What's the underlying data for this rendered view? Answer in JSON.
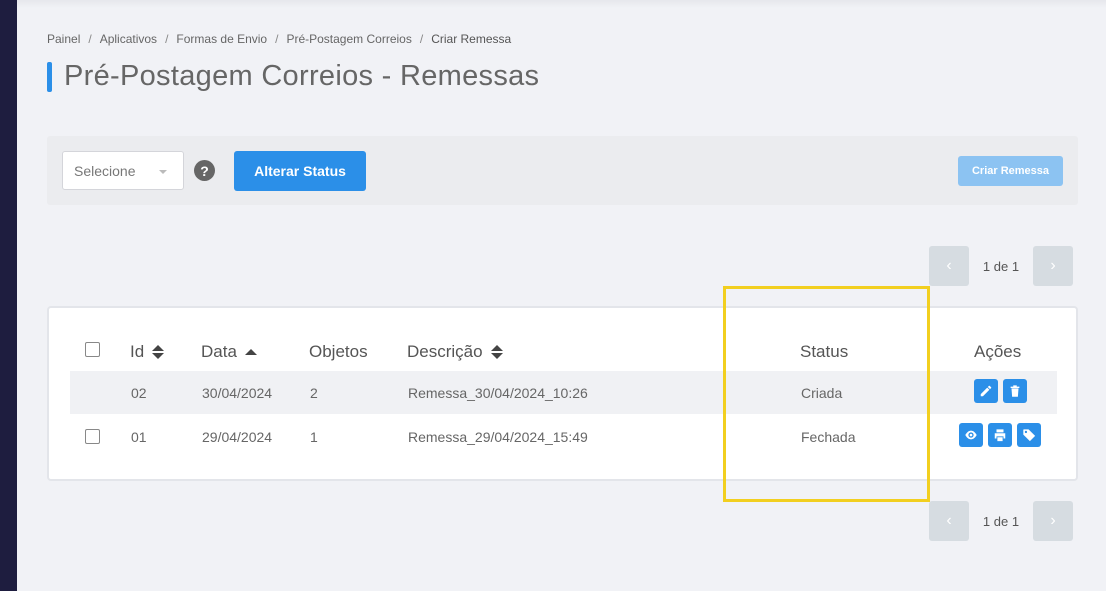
{
  "breadcrumb": {
    "items": [
      "Painel",
      "Aplicativos",
      "Formas de Envio",
      "Pré-Postagem Correios",
      "Criar Remessa"
    ],
    "separator": "/"
  },
  "page": {
    "title": "Pré-Postagem Correios - Remessas",
    "accent_color": "#2b8fe8"
  },
  "toolbar": {
    "select_value": "Selecione",
    "help_symbol": "?",
    "alter_status_label": "Alterar Status",
    "create_label": "Criar Remessa"
  },
  "pagination": {
    "text": "1 de 1",
    "prev_symbol": "‹",
    "next_symbol": "›"
  },
  "table": {
    "headers": {
      "id": "Id",
      "data": "Data",
      "objetos": "Objetos",
      "descricao": "Descrição",
      "status": "Status",
      "acoes": "Ações"
    },
    "rows": [
      {
        "id": "02",
        "data": "30/04/2024",
        "objetos": "2",
        "descricao": "Remessa_30/04/2024_10:26",
        "status": "Criada",
        "actions": [
          "edit-icon",
          "trash-icon"
        ]
      },
      {
        "id": "01",
        "data": "29/04/2024",
        "objetos": "1",
        "descricao": "Remessa_29/04/2024_15:49",
        "status": "Fechada",
        "actions": [
          "eye-icon",
          "print-icon",
          "tag-icon"
        ]
      }
    ]
  },
  "highlight_color": "#f2cf1f"
}
